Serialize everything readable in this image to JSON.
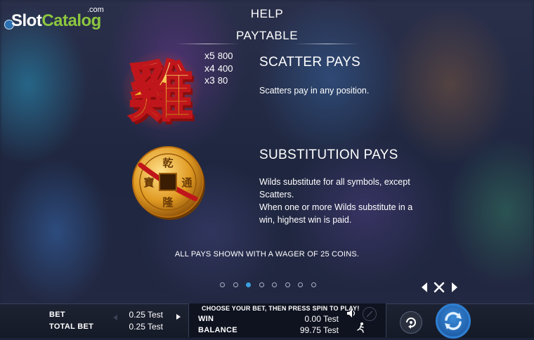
{
  "logo": {
    "text_a": "Slot",
    "text_b": "Catalog",
    "tld": ".com"
  },
  "header": {
    "title": "HELP",
    "subtitle": "PAYTABLE"
  },
  "scatter": {
    "symbol_char": "雞",
    "pays": [
      {
        "mult": "x5",
        "value": "800"
      },
      {
        "mult": "x4",
        "value": "400"
      },
      {
        "mult": "x3",
        "value": "80"
      }
    ],
    "title": "SCATTER PAYS",
    "text": "Scatters pay in any position."
  },
  "wild": {
    "coin_chars": [
      "乾",
      "通",
      "隆",
      "寶"
    ],
    "title": "SUBSTITUTION PAYS",
    "text_1": "Wilds substitute for all symbols, except Scatters.",
    "text_2": "When one or more Wilds substitute in a win, highest win is paid."
  },
  "note": "ALL PAYS SHOWN WITH A WAGER OF 25 COINS.",
  "pagination": {
    "count": 8,
    "active_index": 2
  },
  "bottom": {
    "bet_label": "BET",
    "bet_value": "0.25 Test",
    "total_bet_label": "TOTAL BET",
    "total_bet_value": "0.25 Test",
    "message": "CHOOSE YOUR BET, THEN PRESS SPIN TO PLAY!",
    "win_label": "WIN",
    "win_value": "0.00 Test",
    "balance_label": "BALANCE",
    "balance_value": "99.75 Test"
  },
  "colors": {
    "accent_blue": "#3aa0e0",
    "logo_green": "#8cc63f",
    "gold": "#e0a020",
    "red": "#c0161b"
  }
}
